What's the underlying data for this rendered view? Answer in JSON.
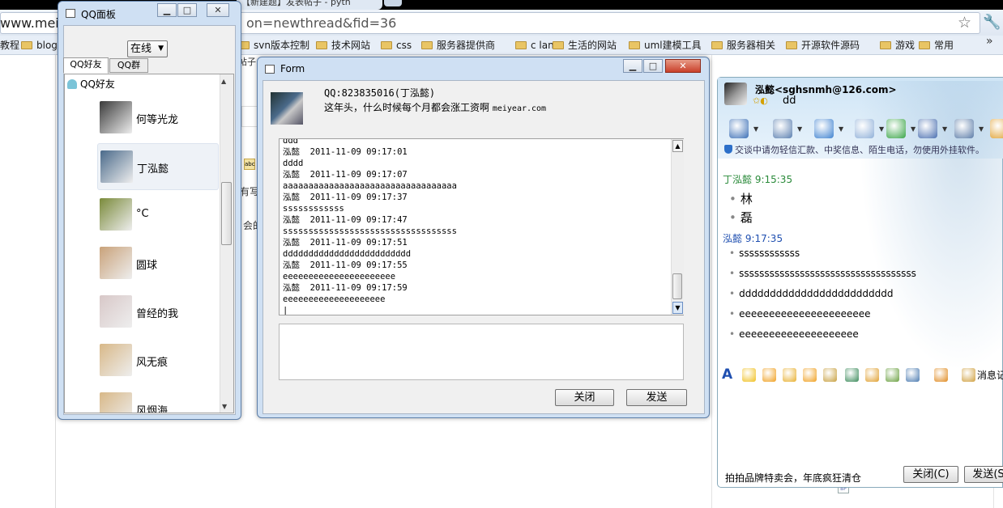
{
  "browser": {
    "bg_tab_label": "【新建题】发表帖子 - pyth",
    "url_visible": "www.meiyea",
    "url_tail": "on=newthread&fid=36",
    "bookmarks": [
      "教程",
      "blog",
      "svn版本控制",
      "技术网站",
      "css",
      "服务器提供商",
      "c lan",
      "生活的网站",
      "uml建模工具",
      "服务器相关",
      "开源软件源码",
      "游戏",
      "常用"
    ],
    "more": "»"
  },
  "page": {
    "frag1": "有写",
    "frag2": "会的",
    "frag3": "帖子"
  },
  "qq_panel": {
    "title": "QQ面板",
    "status": "在线",
    "tabs": [
      "QQ好友",
      "QQ群"
    ],
    "tree_root": "QQ好友",
    "friends": [
      {
        "name": "何等光龙",
        "avatar_color": "#3a3a3a"
      },
      {
        "name": "丁泓懿",
        "avatar_color": "#4a6a8a"
      },
      {
        "name": "°C",
        "avatar_color": "#7a8a3a"
      },
      {
        "name": "圆球",
        "avatar_color": "#c9a27a"
      },
      {
        "name": "曾经的我",
        "avatar_color": "#d8c8c8"
      },
      {
        "name": "风无痕",
        "avatar_color": "#d8b888"
      },
      {
        "name": "风烟海",
        "avatar_color": "#d8b888"
      }
    ]
  },
  "form": {
    "title": "Form",
    "qq_line": "QQ:823835016(丁泓懿)",
    "signature": "这年头，什么时候每个月都会涨工资啊",
    "signature_en": "meiyear.com",
    "log": [
      "ddd",
      "泓懿  2011-11-09 09:17:01",
      "dddd",
      "泓懿  2011-11-09 09:17:07",
      "aaaaaaaaaaaaaaaaaaaaaaaaaaaaaaaaaa",
      "泓懿  2011-11-09 09:17:37",
      "ssssssssssss",
      "泓懿  2011-11-09 09:17:47",
      "ssssssssssssssssssssssssssssssssss",
      "泓懿  2011-11-09 09:17:51",
      "ddddddddddddddddddddddddd",
      "泓懿  2011-11-09 09:17:55",
      "eeeeeeeeeeeeeeeeeeeeee",
      "泓懿  2011-11-09 09:17:59",
      "eeeeeeeeeeeeeeeeeeee",
      "|"
    ],
    "close_label": "关闭",
    "send_label": "发送"
  },
  "qq_chat": {
    "name": "泓懿<sghsnmh@126.com>",
    "signature": "dd",
    "warning": "交谈中请勿轻信汇款、中奖信息、陌生电话，勿使用外挂软件。",
    "messages": [
      {
        "sender": "丁泓懿  9:15:35",
        "sender_color": "#2a8a3a",
        "lines": [
          "林",
          "磊"
        ],
        "big": true
      },
      {
        "sender": "泓懿  9:17:35",
        "sender_color": "#1f4fb0",
        "lines": [
          "ssssssssssss",
          "sssssssssssssssssssssssssssssssssss",
          "ddddddddddddddddddddddddd",
          "eeeeeeeeeeeeeeeeeeeeee",
          "eeeeeeeeeeeeeeeeeeee"
        ],
        "big": false
      }
    ],
    "msg_record": "消息记",
    "ad": "拍拍品牌特卖会，年底疯狂清仓",
    "close_label": "关闭(C)",
    "send_label": "发送(S"
  },
  "colors": {
    "window_frame": "#cfe0f3",
    "close_red": "#c9402a"
  }
}
